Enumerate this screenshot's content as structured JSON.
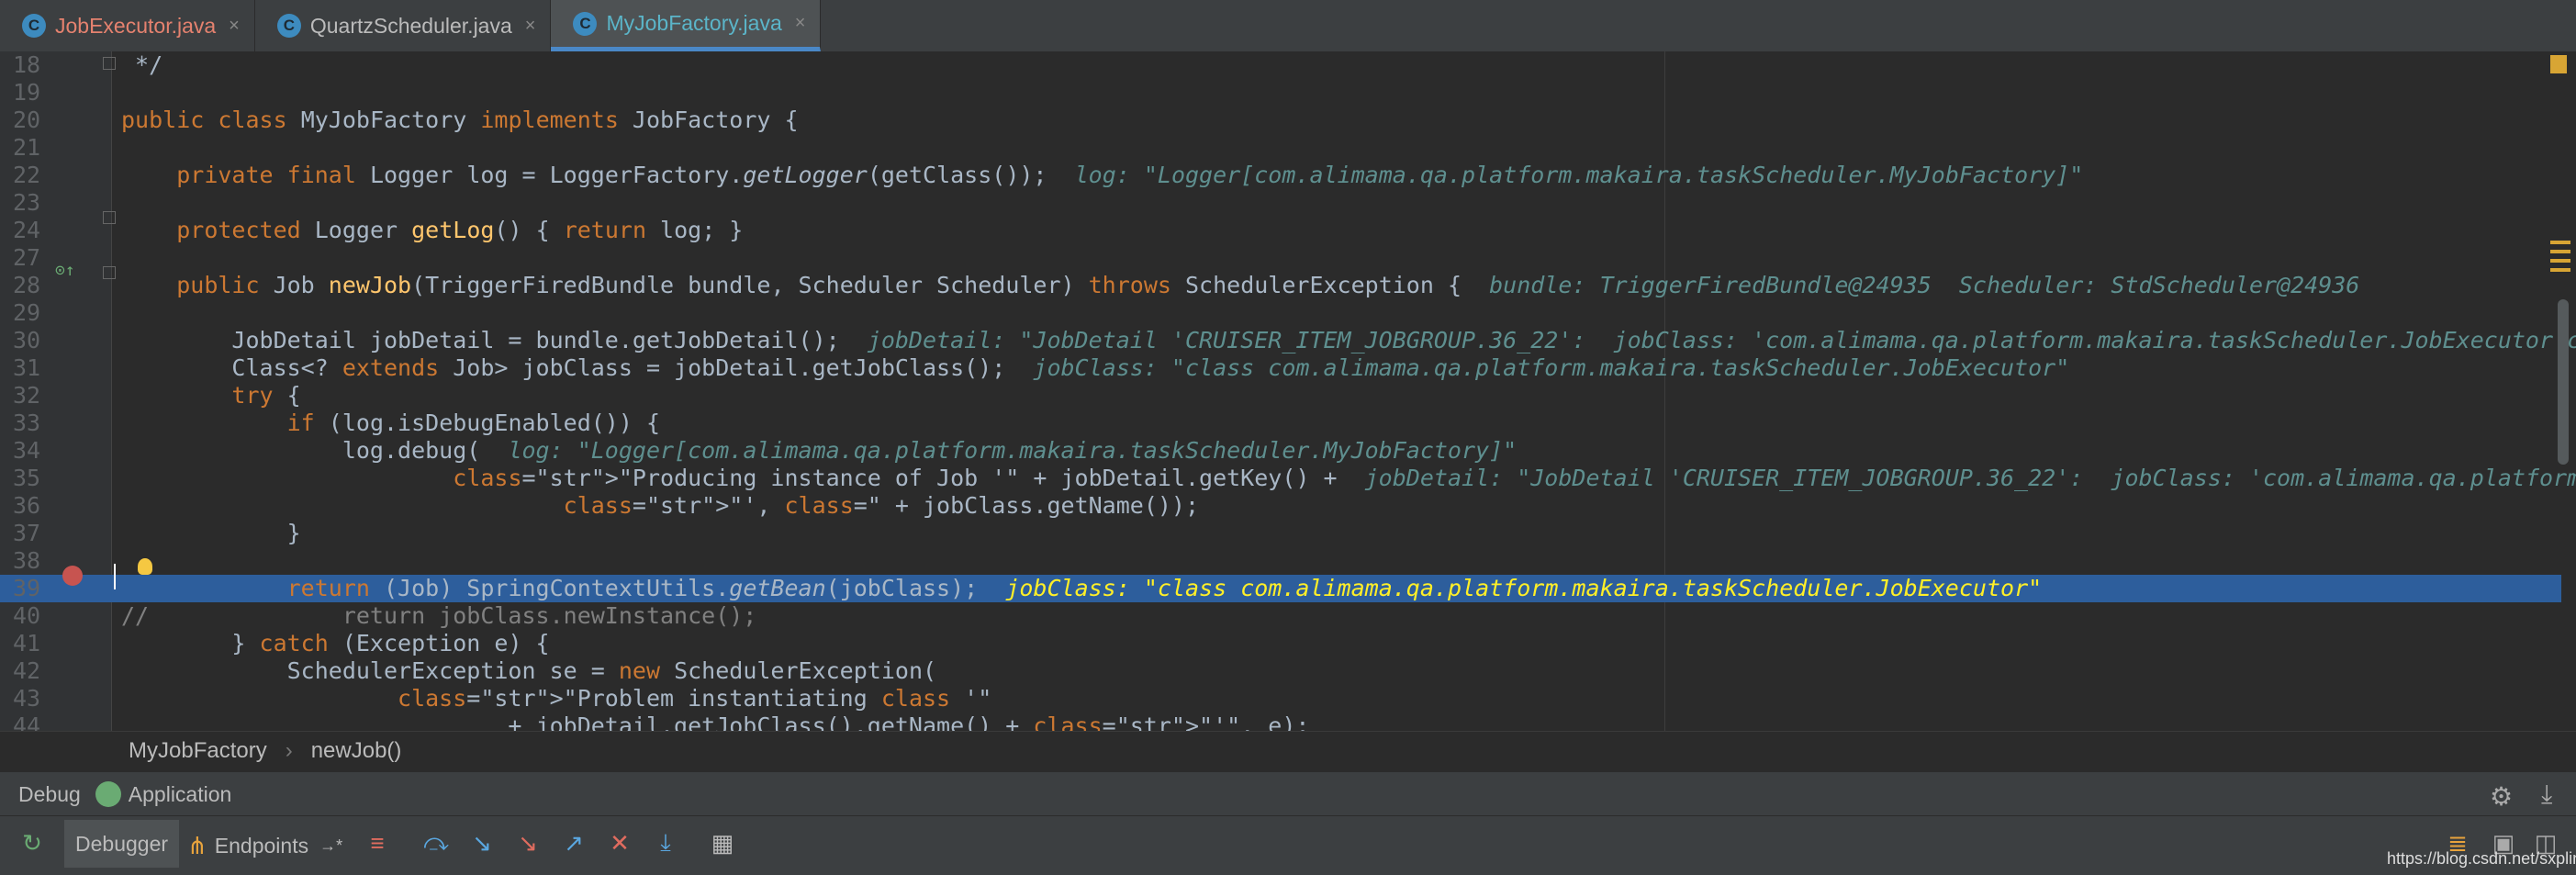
{
  "tabs": [
    {
      "label": "JobExecutor.java",
      "icon": "C"
    },
    {
      "label": "QuartzScheduler.java",
      "icon": "C"
    },
    {
      "label": "MyJobFactory.java",
      "icon": "C"
    }
  ],
  "lines": [
    {
      "n": "18",
      "text": " */"
    },
    {
      "n": "19",
      "text": ""
    },
    {
      "n": "20",
      "text": "public class MyJobFactory implements JobFactory {"
    },
    {
      "n": "21",
      "text": ""
    },
    {
      "n": "22",
      "text": "    private final Logger log = LoggerFactory.getLogger(getClass());  log: \"Logger[com.alimama.qa.platform.makaira.taskScheduler.MyJobFactory]\""
    },
    {
      "n": "23",
      "text": ""
    },
    {
      "n": "24",
      "text": "    protected Logger getLog() { return log; }"
    },
    {
      "n": "27",
      "text": ""
    },
    {
      "n": "28",
      "text": "    public Job newJob(TriggerFiredBundle bundle, Scheduler Scheduler) throws SchedulerException {  bundle: TriggerFiredBundle@24935  Scheduler: StdScheduler@24936"
    },
    {
      "n": "29",
      "text": ""
    },
    {
      "n": "30",
      "text": "        JobDetail jobDetail = bundle.getJobDetail();  jobDetail: \"JobDetail 'CRUISER_ITEM_JOBGROUP.36_22':  jobClass: 'com.alimama.qa.platform.makaira.taskScheduler.JobExecutor concurrentExec"
    },
    {
      "n": "31",
      "text": "        Class<? extends Job> jobClass = jobDetail.getJobClass();  jobClass: \"class com.alimama.qa.platform.makaira.taskScheduler.JobExecutor\""
    },
    {
      "n": "32",
      "text": "        try {"
    },
    {
      "n": "33",
      "text": "            if (log.isDebugEnabled()) {"
    },
    {
      "n": "34",
      "text": "                log.debug(  log: \"Logger[com.alimama.qa.platform.makaira.taskScheduler.MyJobFactory]\""
    },
    {
      "n": "35",
      "text": "                        \"Producing instance of Job '\" + jobDetail.getKey() +  jobDetail: \"JobDetail 'CRUISER_ITEM_JOBGROUP.36_22':  jobClass: 'com.alimama.qa.platform.makaira.taskScheduler.Jo"
    },
    {
      "n": "36",
      "text": "                                \"', class=\" + jobClass.getName());"
    },
    {
      "n": "37",
      "text": "            }"
    },
    {
      "n": "38",
      "text": ""
    },
    {
      "n": "39",
      "text": "            return (Job) SpringContextUtils.getBean(jobClass);  jobClass: \"class com.alimama.qa.platform.makaira.taskScheduler.JobExecutor\""
    },
    {
      "n": "40",
      "text": "//              return jobClass.newInstance();"
    },
    {
      "n": "41",
      "text": "        } catch (Exception e) {"
    },
    {
      "n": "42",
      "text": "            SchedulerException se = new SchedulerException("
    },
    {
      "n": "43",
      "text": "                    \"Problem instantiating class '\""
    },
    {
      "n": "44",
      "text": "                            + jobDetail.getJobClass().getName() + \"'\", e);"
    }
  ],
  "breadcrumb": {
    "class_name": "MyJobFactory",
    "method_name": "newJob()",
    "separator": "›"
  },
  "debug": {
    "label": "Debug",
    "config": "Application"
  },
  "toolbar": {
    "debugger_tab": "Debugger",
    "endpoints_tab": "Endpoints",
    "endpoints_arrow": "→*"
  },
  "watermark": "https://blog.csdn.net/sxpline",
  "colors": {
    "tab_modified": "#e5826f",
    "tab_active": "#5bb5c9",
    "highlight_line": "#2d5e9c",
    "breakpoint": "#c75450"
  }
}
